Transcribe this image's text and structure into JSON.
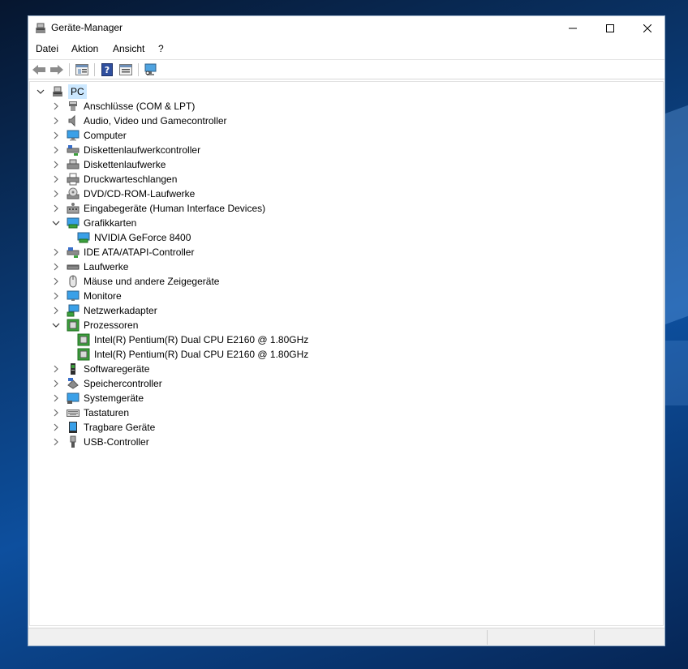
{
  "window": {
    "title": "Geräte-Manager"
  },
  "menu": {
    "items": [
      "Datei",
      "Aktion",
      "Ansicht",
      "?"
    ]
  },
  "toolbar": {
    "buttons": [
      "back-icon",
      "forward-icon",
      "properties-icon",
      "help-icon",
      "show-view-icon",
      "monitor-scan-icon"
    ]
  },
  "tree": {
    "root": "PC",
    "categories": [
      {
        "label": "Anschlüsse (COM & LPT)",
        "icon": "port-icon",
        "expanded": false
      },
      {
        "label": "Audio, Video und Gamecontroller",
        "icon": "speaker-icon",
        "expanded": false
      },
      {
        "label": "Computer",
        "icon": "computer-icon",
        "expanded": false
      },
      {
        "label": "Diskettenlaufwerkcontroller",
        "icon": "floppy-controller-icon",
        "expanded": false
      },
      {
        "label": "Diskettenlaufwerke",
        "icon": "floppy-drive-icon",
        "expanded": false
      },
      {
        "label": "Druckwarteschlangen",
        "icon": "printer-icon",
        "expanded": false
      },
      {
        "label": "DVD/CD-ROM-Laufwerke",
        "icon": "cdrom-icon",
        "expanded": false
      },
      {
        "label": "Eingabegeräte (Human Interface Devices)",
        "icon": "hid-icon",
        "expanded": false
      },
      {
        "label": "Grafikkarten",
        "icon": "display-adapter-icon",
        "expanded": true,
        "children": [
          "NVIDIA GeForce 8400"
        ]
      },
      {
        "label": "IDE ATA/ATAPI-Controller",
        "icon": "ide-controller-icon",
        "expanded": false
      },
      {
        "label": "Laufwerke",
        "icon": "disk-drive-icon",
        "expanded": false
      },
      {
        "label": "Mäuse und andere Zeigegeräte",
        "icon": "mouse-icon",
        "expanded": false
      },
      {
        "label": "Monitore",
        "icon": "monitor-icon",
        "expanded": false
      },
      {
        "label": "Netzwerkadapter",
        "icon": "network-adapter-icon",
        "expanded": false
      },
      {
        "label": "Prozessoren",
        "icon": "processor-icon",
        "expanded": true,
        "children": [
          "Intel(R) Pentium(R) Dual  CPU  E2160  @ 1.80GHz",
          "Intel(R) Pentium(R) Dual  CPU  E2160  @ 1.80GHz"
        ]
      },
      {
        "label": "Softwaregeräte",
        "icon": "software-device-icon",
        "expanded": false
      },
      {
        "label": "Speichercontroller",
        "icon": "storage-controller-icon",
        "expanded": false
      },
      {
        "label": "Systemgeräte",
        "icon": "system-device-icon",
        "expanded": false
      },
      {
        "label": "Tastaturen",
        "icon": "keyboard-icon",
        "expanded": false
      },
      {
        "label": "Tragbare Geräte",
        "icon": "portable-device-icon",
        "expanded": false
      },
      {
        "label": "USB-Controller",
        "icon": "usb-icon",
        "expanded": false
      }
    ]
  },
  "colors": {
    "selection": "#cce8ff",
    "accent": "#0078d7",
    "desktop": "#0b3d7a"
  }
}
